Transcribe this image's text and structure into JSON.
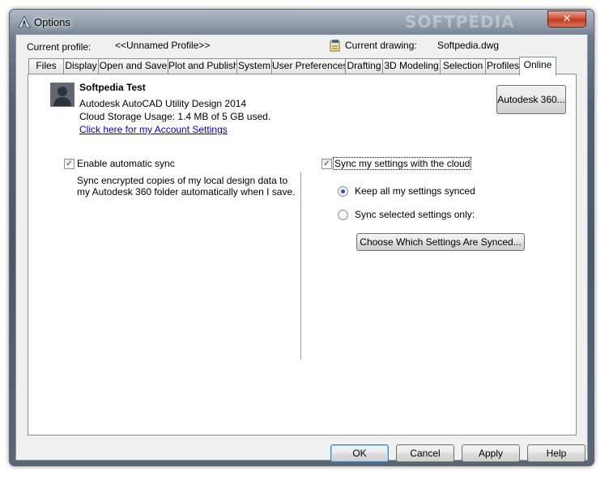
{
  "window": {
    "title": "Options",
    "watermark": "SOFTPEDIA"
  },
  "profile": {
    "label": "Current profile:",
    "value": "<<Unnamed Profile>>",
    "drawing_label": "Current drawing:",
    "drawing_value": "Softpedia.dwg"
  },
  "tabs": [
    {
      "label": "Files"
    },
    {
      "label": "Display"
    },
    {
      "label": "Open and Save"
    },
    {
      "label": "Plot and Publish"
    },
    {
      "label": "System"
    },
    {
      "label": "User Preferences"
    },
    {
      "label": "Drafting"
    },
    {
      "label": "3D Modeling"
    },
    {
      "label": "Selection"
    },
    {
      "label": "Profiles"
    },
    {
      "label": "Online"
    }
  ],
  "active_tab": "Online",
  "account": {
    "name": "Softpedia Test",
    "product": "Autodesk AutoCAD Utility Design 2014",
    "storage": "Cloud Storage Usage: 1.4 MB of 5 GB used.",
    "link": "Click here for my Account Settings",
    "a360_button": "Autodesk 360..."
  },
  "auto_sync": {
    "label": "Enable automatic sync",
    "checked": true,
    "description": "Sync encrypted copies of my local design data to my Autodesk 360 folder automatically when I save."
  },
  "cloud_sync": {
    "label": "Sync my settings with the cloud",
    "checked": true,
    "option_all": "Keep all my settings synced",
    "option_selected": "Sync selected settings only:",
    "selected_option": "Keep all my settings synced",
    "choose_button": "Choose Which Settings Are Synced..."
  },
  "footer": {
    "ok": "OK",
    "cancel": "Cancel",
    "apply": "Apply",
    "help": "Help"
  },
  "colors": {
    "link": "#0000cc",
    "radio_selected": "#1e56c8",
    "close_button": "#c13c1d"
  }
}
